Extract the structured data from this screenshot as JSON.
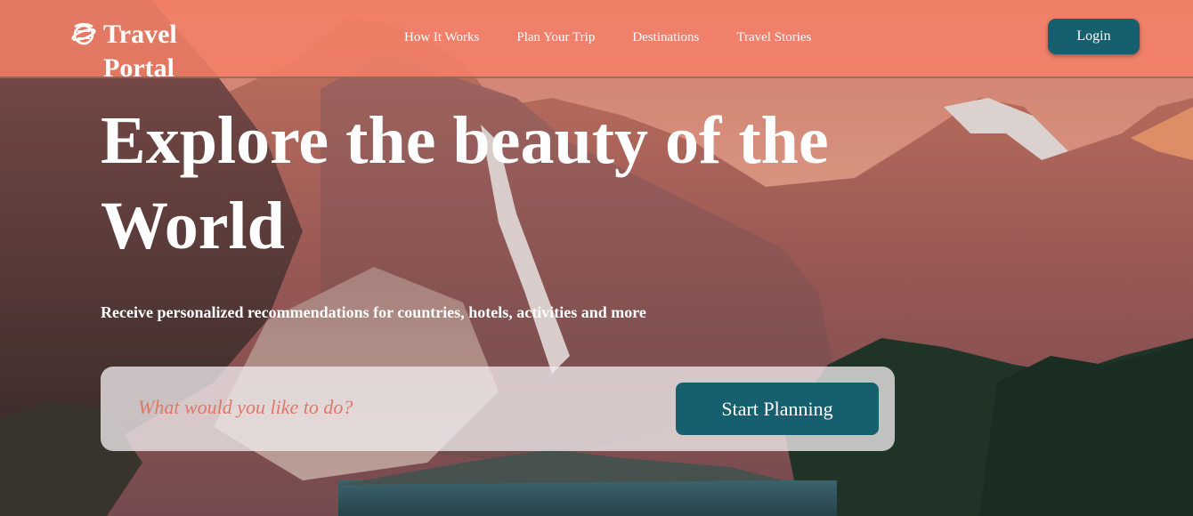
{
  "brand": {
    "name": "Travel Portal"
  },
  "nav": {
    "links": [
      {
        "label": "How It Works"
      },
      {
        "label": "Plan Your Trip"
      },
      {
        "label": "Destinations"
      },
      {
        "label": "Travel Stories"
      }
    ],
    "login_label": "Login"
  },
  "hero": {
    "headline": "Explore the beauty of the World",
    "subtitle": "Receive personalized recommendations for countries, hotels, activities and more",
    "search_placeholder": "What would you like to do?",
    "cta_label": "Start Planning",
    "background_image": "mountain-lake-sunset"
  },
  "colors": {
    "navbar": "#f48068",
    "button": "#155f6e",
    "placeholder": "#e07666",
    "text": "#ffffff"
  },
  "icons": {
    "logo": "globe-icon"
  }
}
